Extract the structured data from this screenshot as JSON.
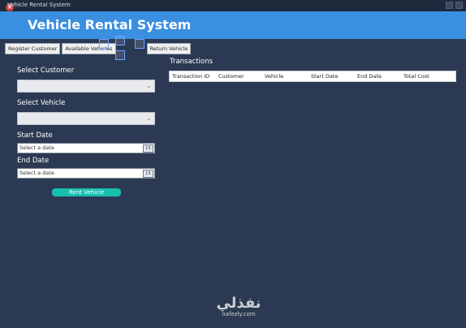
{
  "window": {
    "title": "Vehicle Rental System"
  },
  "header": {
    "title": "Vehicle Rental System",
    "accent": "#3b8fe0"
  },
  "tabs": [
    {
      "label": "Register Customer"
    },
    {
      "label": "Available Vehicles"
    },
    {
      "label": "Return Vehicle"
    }
  ],
  "form": {
    "customer_label": "Select Customer",
    "vehicle_label": "Select Vehicle",
    "start_label": "Start Date",
    "end_label": "End Date",
    "start_placeholder": "Select a date",
    "end_placeholder": "Select a date",
    "calendar_glyph": "15",
    "rent_button": "Rent Vehicle",
    "rent_color": "#19bfae"
  },
  "transactions": {
    "label": "Transactions",
    "columns": [
      "Transaction ID",
      "Customer",
      "Vehicle",
      "Start Date",
      "End Date",
      "Total Cost"
    ]
  },
  "watermark": {
    "arabic": "نفذلي",
    "latin": "nafezly.com"
  }
}
